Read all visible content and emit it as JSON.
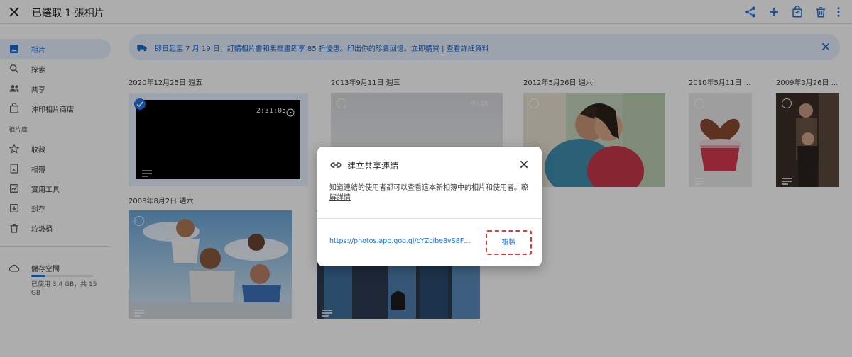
{
  "topbar": {
    "title": "已選取 1 張相片",
    "icons": [
      "close-icon",
      "share-icon",
      "add-icon",
      "shopping-bag-icon",
      "trash-icon",
      "more-vert-icon"
    ]
  },
  "sidebar": {
    "items": [
      {
        "label": "相片",
        "icon": "photo-icon",
        "active": true
      },
      {
        "label": "探索",
        "icon": "search-icon"
      },
      {
        "label": "共享",
        "icon": "people-icon"
      },
      {
        "label": "沖印相片商店",
        "icon": "shopping-bag-icon"
      },
      {
        "label": "收藏",
        "icon": "star-icon"
      },
      {
        "label": "相簿",
        "icon": "album-icon"
      },
      {
        "label": "實用工具",
        "icon": "utilities-icon"
      },
      {
        "label": "封存",
        "icon": "archive-icon"
      },
      {
        "label": "垃圾桶",
        "icon": "trash-icon"
      }
    ],
    "library_heading": "相片庫",
    "storage": {
      "label": "儲存空間",
      "used_fraction": 0.23,
      "info": "已使用 3.4 GB，共 15 GB"
    }
  },
  "banner": {
    "text": "即日起至 7 月 19 日，訂購相片書和無框畫即享 85 折優惠。印出你的珍貴回憶。",
    "link_buy": "立即購買",
    "link_separator": " | ",
    "link_details": "查看詳細資料"
  },
  "groups": [
    {
      "date": "2020年12月25日 週五",
      "duration": "2:31:05"
    },
    {
      "date": "2013年9月11日 週三",
      "duration": "0:16"
    },
    {
      "date": "2012年5月26日 週六"
    },
    {
      "date": "2010年5月11日 ..."
    },
    {
      "date": "2009年3月26日 ..."
    },
    {
      "date": "2008年8月2日 週六"
    },
    {
      "date": "2"
    }
  ],
  "dialog": {
    "title": "建立共享連結",
    "description": "知道連結的使用者都可以查看這本新相簿中的相片和使用者。",
    "learn_more": "瞭解詳情",
    "url": "https://photos.app.goo.gl/cYZcibe8vS8Fj...",
    "copy_label": "複製"
  },
  "colors": {
    "accent": "#1a73e8",
    "banner_bg": "#e8f0fe",
    "highlight_box": "#e53935"
  }
}
